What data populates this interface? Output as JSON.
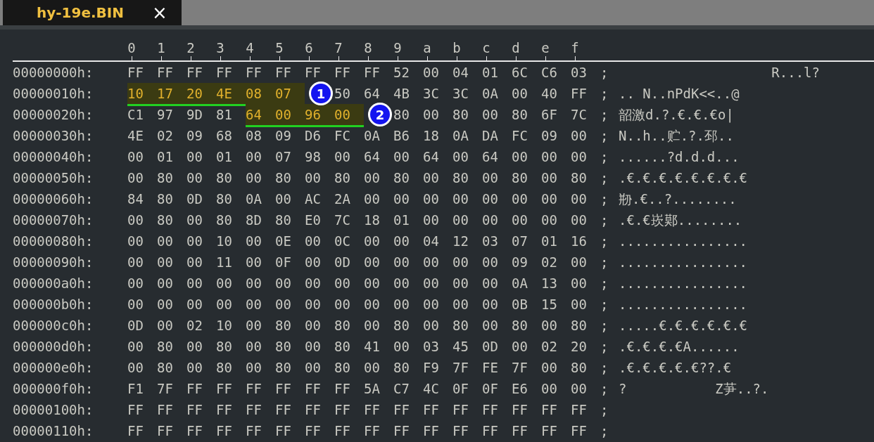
{
  "tab": {
    "title": "hy-19e.BIN",
    "close": "×",
    "selected": true
  },
  "columns": [
    "0",
    "1",
    "2",
    "3",
    "4",
    "5",
    "6",
    "7",
    "8",
    "9",
    "a",
    "b",
    "c",
    "d",
    "e",
    "f"
  ],
  "rows": [
    {
      "address": "00000000h:",
      "segments": [
        {
          "bytes": [
            "FF",
            "FF",
            "FF",
            "FF",
            "FF",
            "FF",
            "FF",
            "FF",
            "FF",
            "52",
            "00",
            "04",
            "01",
            "6C",
            "C6",
            "03"
          ],
          "highlighted": false
        }
      ],
      "separator": ";",
      "text": "                   R...l?"
    },
    {
      "address": "00000010h:",
      "segments": [
        {
          "bytes": [
            "10",
            "17",
            "20",
            "4E",
            "08",
            "07"
          ],
          "highlighted": true,
          "callout": "1"
        },
        {
          "bytes": [
            "50",
            "64",
            "4B",
            "3C",
            "3C",
            "0A",
            "00",
            "40",
            "FF"
          ],
          "highlighted": false
        }
      ],
      "separator": ";",
      "text": ".. N..nPdK<<..@"
    },
    {
      "address": "00000020h:",
      "segments": [
        {
          "bytes": [
            "C1",
            "97",
            "9D",
            "81"
          ],
          "highlighted": false
        },
        {
          "bytes": [
            "64",
            "00",
            "96",
            "00"
          ],
          "highlighted": true,
          "callout": "2"
        },
        {
          "bytes": [
            "80",
            "00",
            "80",
            "00",
            "80",
            "6F",
            "7C"
          ],
          "highlighted": false
        }
      ],
      "separator": ";",
      "text": "韶激d.?.€.€.€o|"
    },
    {
      "address": "00000030h:",
      "segments": [
        {
          "bytes": [
            "4E",
            "02",
            "09",
            "68",
            "08",
            "09",
            "D6",
            "FC",
            "0A",
            "B6",
            "18",
            "0A",
            "DA",
            "FC",
            "09",
            "00"
          ],
          "highlighted": false
        }
      ],
      "separator": ";",
      "text": "N..h..贮.?.邳.."
    },
    {
      "address": "00000040h:",
      "segments": [
        {
          "bytes": [
            "00",
            "01",
            "00",
            "01",
            "00",
            "07",
            "98",
            "00",
            "64",
            "00",
            "64",
            "00",
            "64",
            "00",
            "00",
            "00"
          ],
          "highlighted": false
        }
      ],
      "separator": ";",
      "text": "......?d.d.d..."
    },
    {
      "address": "00000050h:",
      "segments": [
        {
          "bytes": [
            "00",
            "80",
            "00",
            "80",
            "00",
            "80",
            "00",
            "80",
            "00",
            "80",
            "00",
            "80",
            "00",
            "80",
            "00",
            "80"
          ],
          "highlighted": false
        }
      ],
      "separator": ";",
      "text": ".€.€.€.€.€.€.€.€"
    },
    {
      "address": "00000060h:",
      "segments": [
        {
          "bytes": [
            "84",
            "80",
            "0D",
            "80",
            "0A",
            "00",
            "AC",
            "2A",
            "00",
            "00",
            "00",
            "00",
            "00",
            "00",
            "00",
            "00"
          ],
          "highlighted": false
        }
      ],
      "separator": ";",
      "text": "剙.€..?........"
    },
    {
      "address": "00000070h:",
      "segments": [
        {
          "bytes": [
            "00",
            "80",
            "00",
            "80",
            "8D",
            "80",
            "E0",
            "7C",
            "18",
            "01",
            "00",
            "00",
            "00",
            "00",
            "00",
            "00"
          ],
          "highlighted": false
        }
      ],
      "separator": ";",
      "text": ".€.€崁鄚........"
    },
    {
      "address": "00000080h:",
      "segments": [
        {
          "bytes": [
            "00",
            "00",
            "00",
            "10",
            "00",
            "0E",
            "00",
            "0C",
            "00",
            "00",
            "04",
            "12",
            "03",
            "07",
            "01",
            "16"
          ],
          "highlighted": false
        }
      ],
      "separator": ";",
      "text": "................"
    },
    {
      "address": "00000090h:",
      "segments": [
        {
          "bytes": [
            "00",
            "00",
            "00",
            "11",
            "00",
            "0F",
            "00",
            "0D",
            "00",
            "00",
            "00",
            "00",
            "00",
            "09",
            "02",
            "00"
          ],
          "highlighted": false
        }
      ],
      "separator": ";",
      "text": "................"
    },
    {
      "address": "000000a0h:",
      "segments": [
        {
          "bytes": [
            "00",
            "00",
            "00",
            "00",
            "00",
            "00",
            "00",
            "00",
            "00",
            "00",
            "00",
            "00",
            "00",
            "0A",
            "13",
            "00"
          ],
          "highlighted": false
        }
      ],
      "separator": ";",
      "text": "................"
    },
    {
      "address": "000000b0h:",
      "segments": [
        {
          "bytes": [
            "00",
            "00",
            "00",
            "00",
            "00",
            "00",
            "00",
            "00",
            "00",
            "00",
            "00",
            "00",
            "00",
            "0B",
            "15",
            "00"
          ],
          "highlighted": false
        }
      ],
      "separator": ";",
      "text": "................"
    },
    {
      "address": "000000c0h:",
      "segments": [
        {
          "bytes": [
            "0D",
            "00",
            "02",
            "10",
            "00",
            "80",
            "00",
            "80",
            "00",
            "80",
            "00",
            "80",
            "00",
            "80",
            "00",
            "80"
          ],
          "highlighted": false
        }
      ],
      "separator": ";",
      "text": ".....€.€.€.€.€.€"
    },
    {
      "address": "000000d0h:",
      "segments": [
        {
          "bytes": [
            "00",
            "80",
            "00",
            "80",
            "00",
            "80",
            "00",
            "80",
            "41",
            "00",
            "03",
            "45",
            "0D",
            "00",
            "02",
            "20"
          ],
          "highlighted": false
        }
      ],
      "separator": ";",
      "text": ".€.€.€.€A......"
    },
    {
      "address": "000000e0h:",
      "segments": [
        {
          "bytes": [
            "00",
            "80",
            "00",
            "80",
            "00",
            "80",
            "00",
            "80",
            "00",
            "80",
            "F9",
            "7F",
            "FE",
            "7F",
            "00",
            "80"
          ],
          "highlighted": false
        }
      ],
      "separator": ";",
      "text": ".€.€.€.€.€??.€"
    },
    {
      "address": "000000f0h:",
      "segments": [
        {
          "bytes": [
            "F1",
            "7F",
            "FF",
            "FF",
            "FF",
            "FF",
            "FF",
            "FF",
            "5A",
            "C7",
            "4C",
            "0F",
            "0F",
            "E6",
            "00",
            "00"
          ],
          "highlighted": false
        }
      ],
      "separator": ";",
      "text": "?           Z芛..?."
    },
    {
      "address": "00000100h:",
      "segments": [
        {
          "bytes": [
            "FF",
            "FF",
            "FF",
            "FF",
            "FF",
            "FF",
            "FF",
            "FF",
            "FF",
            "FF",
            "FF",
            "FF",
            "FF",
            "FF",
            "FF",
            "FF"
          ],
          "highlighted": false
        }
      ],
      "separator": ";"
    },
    {
      "address": "00000110h:",
      "segments": [
        {
          "bytes": [
            "FF",
            "FF",
            "FF",
            "FF",
            "FF",
            "FF",
            "FF",
            "FF",
            "FF",
            "FF",
            "FF",
            "FF",
            "FF",
            "FF",
            "FF",
            "FF"
          ],
          "highlighted": false
        }
      ],
      "separator": ";"
    }
  ]
}
